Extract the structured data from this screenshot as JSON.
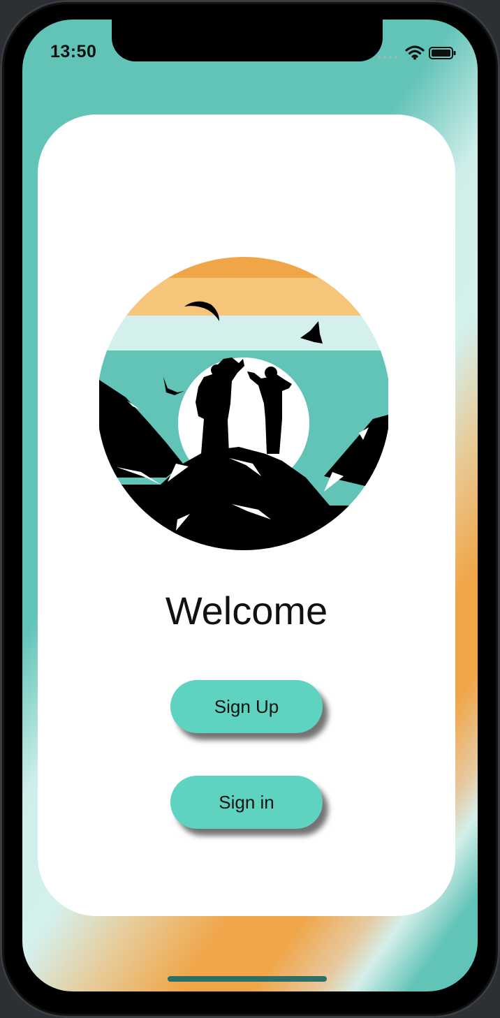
{
  "status_bar": {
    "time": "13:50"
  },
  "main": {
    "welcome_title": "Welcome",
    "sign_up_label": "Sign Up",
    "sign_in_label": "Sign in"
  },
  "colors": {
    "teal": "#62c3b7",
    "button": "#5ed3c0",
    "orange": "#f0a546",
    "light_orange": "#f5c57a",
    "pale_teal": "#d4f0ec"
  },
  "icons": [
    "signal-icon",
    "wifi-icon",
    "battery-icon"
  ]
}
